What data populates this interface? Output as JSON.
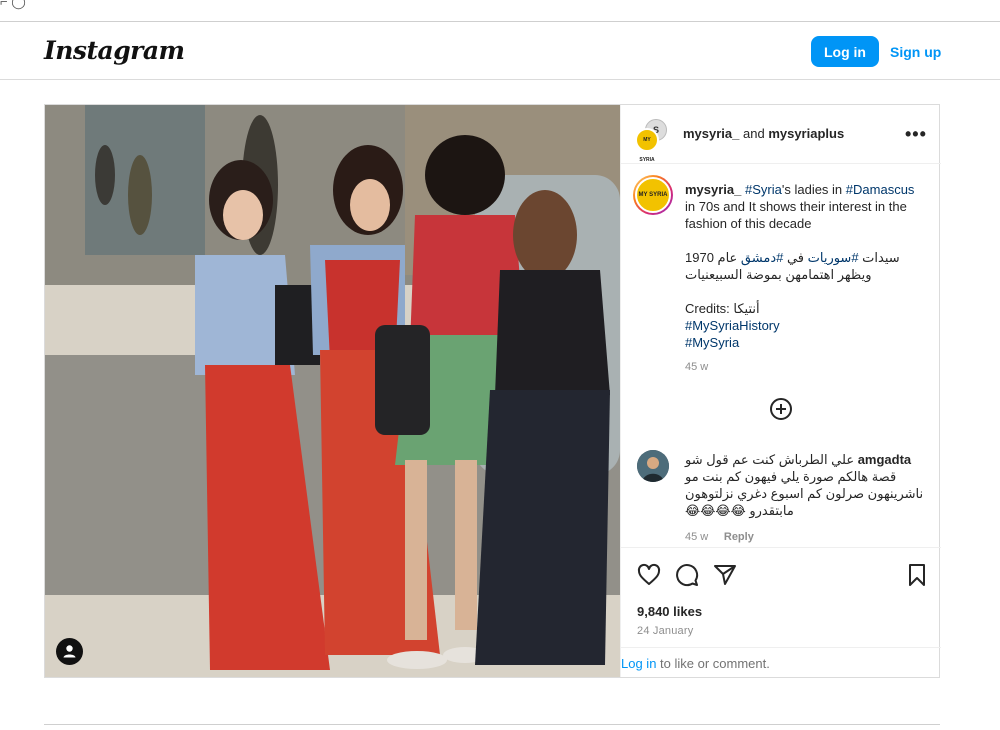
{
  "browser": {
    "stub": "⌐ ◯"
  },
  "header": {
    "logo": "Instagram",
    "login_label": "Log in",
    "signup_label": "Sign up"
  },
  "post": {
    "authors": {
      "user1": "mysyria_",
      "joiner": " and ",
      "user2": "mysyriaplus"
    },
    "avatar_text": "MY SYRIA",
    "avatar_back_text": "S",
    "caption": {
      "username": "mysyria_",
      "tag_syria": "#Syria",
      "text1": "'s ladies in ",
      "tag_damascus": "#Damascus",
      "text2": " in 70s and It shows their interest in the fashion of this decade",
      "ar_line1_a": "سيدات ",
      "ar_tag_syrians": "#سوريات",
      "ar_line1_b": " في ",
      "ar_tag_dimashq": "#دمشق",
      "ar_line1_c": " عام 1970",
      "ar_line2": "ويظهر اهتمامهن بموضة السبيعنيات",
      "credits": "Credits: أنتيكا",
      "tag_history": "#MySyriaHistory",
      "tag_mysyria": "#MySyria",
      "time": "45 w"
    },
    "comment": {
      "username": "amgadta",
      "text": " علي الطرباش كنت عم قول شو قصة هالكم صورة يلي فيهون كم بنت مو ناشرينهون صرلون كم اسبوع دغري نزلتوهون مابتقدرو 😂😂😂😂",
      "time": "45 w",
      "reply_label": "Reply"
    },
    "likes": "9,840 likes",
    "date": "24 January",
    "cta_link": "Log in",
    "cta_text": " to like or comment."
  },
  "colors": {
    "accent": "#0095f6",
    "tag": "#00376b",
    "muted": "#8e8e8e"
  },
  "icons": [
    "more-icon",
    "add-comment-icon",
    "heart-icon",
    "comment-icon",
    "share-icon",
    "bookmark-icon",
    "user-tag-icon"
  ]
}
